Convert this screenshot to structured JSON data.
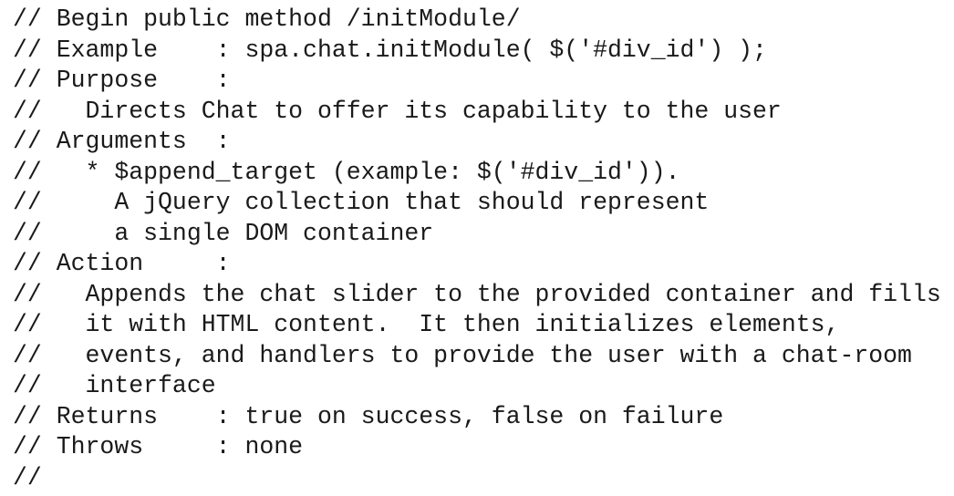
{
  "code": {
    "lines": [
      "// Begin public method /initModule/",
      "// Example    : spa.chat.initModule( $('#div_id') );",
      "// Purpose    :",
      "//   Directs Chat to offer its capability to the user",
      "// Arguments  :",
      "//   * $append_target (example: $('#div_id')).",
      "//     A jQuery collection that should represent",
      "//     a single DOM container",
      "// Action     :",
      "//   Appends the chat slider to the provided container and fills",
      "//   it with HTML content.  It then initializes elements,",
      "//   events, and handlers to provide the user with a chat-room",
      "//   interface",
      "// Returns    : true on success, false on failure",
      "// Throws     : none",
      "//"
    ]
  }
}
